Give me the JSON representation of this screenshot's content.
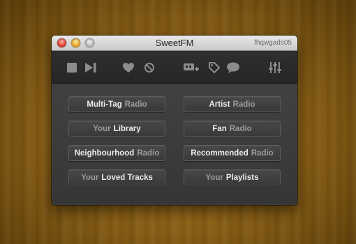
{
  "window": {
    "title": "SweetFM",
    "account": "fhqwgads05"
  },
  "toolbar": {
    "icons": [
      "stop-icon",
      "skip-icon",
      "heart-icon",
      "ban-icon",
      "share-icon",
      "tag-icon",
      "comment-icon",
      "equalizer-icon"
    ]
  },
  "stations": {
    "multi_tag": {
      "part1": "Multi-Tag",
      "part2": "Radio"
    },
    "artist": {
      "part1": "Artist",
      "part2": "Radio"
    },
    "library": {
      "part1": "Your",
      "part2": "Library"
    },
    "fan": {
      "part1": "Fan",
      "part2": "Radio"
    },
    "neighbourhood": {
      "part1": "Neighbourhood",
      "part2": "Radio"
    },
    "recommended": {
      "part1": "Recommended",
      "part2": "Radio"
    },
    "loved": {
      "part1": "Your",
      "part2": "Loved Tracks"
    },
    "playlists": {
      "part1": "Your",
      "part2": "Playlists"
    }
  },
  "colors": {
    "icon": "#8c8c8c",
    "button_text": "#ececec",
    "button_subtext": "#9c9c9c"
  }
}
